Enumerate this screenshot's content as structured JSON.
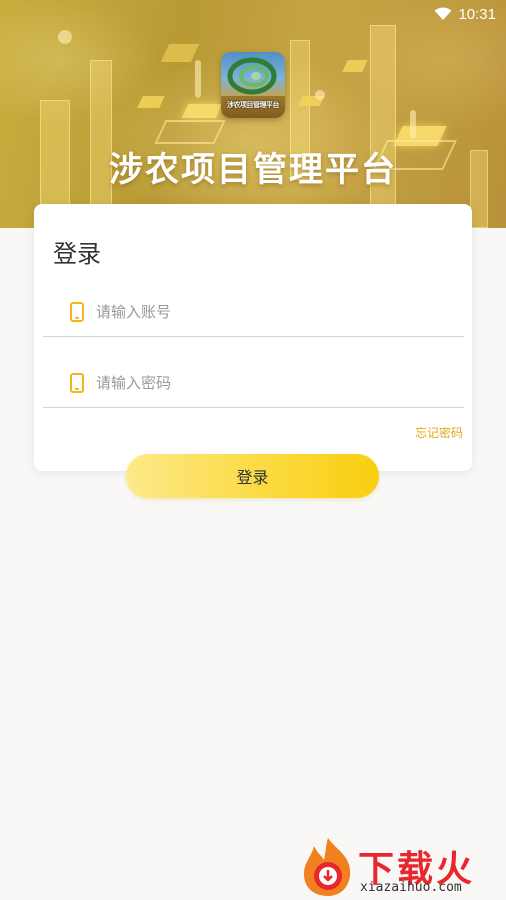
{
  "status_bar": {
    "time": "10:31",
    "wifi_icon": "wifi-icon"
  },
  "header": {
    "logo_text": "涉农项目管理平台",
    "title": "涉农项目管理平台"
  },
  "login": {
    "title": "登录",
    "account_placeholder": "请输入账号",
    "password_placeholder": "请输入密码",
    "field_icon": "phone-icon",
    "forgot_label": "忘记密码",
    "submit_label": "登录"
  },
  "watermark": {
    "name": "下载火",
    "domain": "xiazaihuo.com"
  },
  "colors": {
    "accent": "#f8ce10",
    "link": "#e3a91c",
    "banner": "#c2a33e",
    "watermark": "#e8262b"
  }
}
